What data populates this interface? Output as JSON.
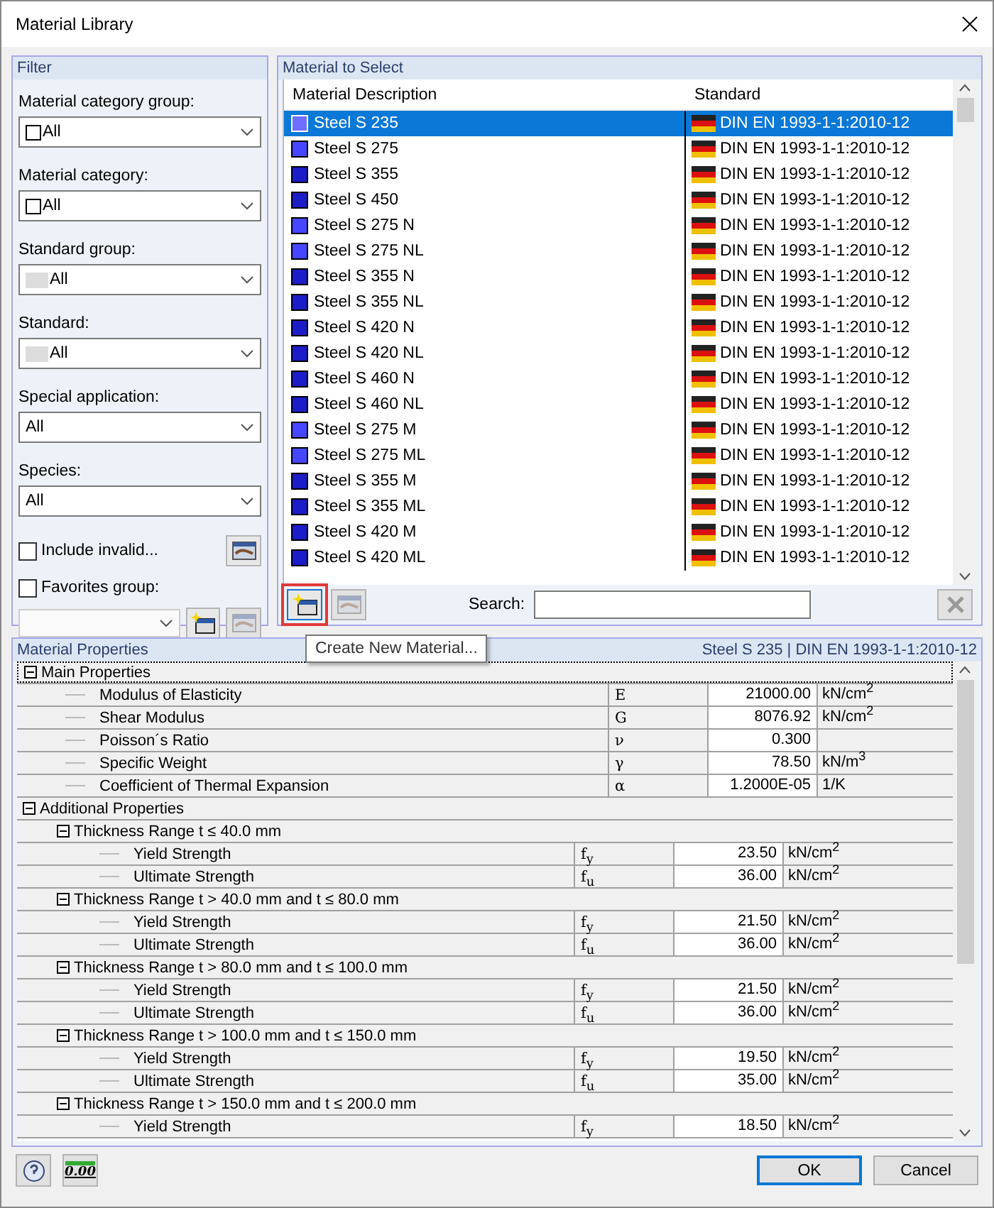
{
  "window": {
    "title": "Material Library"
  },
  "filter": {
    "title": "Filter",
    "fields": [
      {
        "kind": "outlined",
        "label": "Material category group:",
        "value": "All"
      },
      {
        "kind": "outlined",
        "label": "Material category:",
        "value": "All"
      },
      {
        "kind": "shaded",
        "label": "Standard group:",
        "value": "All"
      },
      {
        "kind": "shaded",
        "label": "Standard:",
        "value": "All"
      },
      {
        "kind": "plain",
        "label": "Special application:",
        "value": "All"
      },
      {
        "kind": "plain",
        "label": "Species:",
        "value": "All"
      }
    ],
    "include_invalid": {
      "label": "Include invalid...",
      "checked": false
    },
    "favorites_group": {
      "label": "Favorites group:",
      "checked": false
    }
  },
  "material_list": {
    "title": "Material to Select",
    "columns": [
      "Material Description",
      "Standard"
    ],
    "rows": [
      {
        "name": "Steel S 235",
        "color": "#6e6eff",
        "standard": "DIN EN 1993-1-1:2010-12",
        "selected": true
      },
      {
        "name": "Steel S 275",
        "color": "#4646ff",
        "standard": "DIN EN 1993-1-1:2010-12",
        "selected": false
      },
      {
        "name": "Steel S 355",
        "color": "#1c1cc8",
        "standard": "DIN EN 1993-1-1:2010-12",
        "selected": false
      },
      {
        "name": "Steel S 450",
        "color": "#1c1cc8",
        "standard": "DIN EN 1993-1-1:2010-12",
        "selected": false
      },
      {
        "name": "Steel S 275 N",
        "color": "#4646ff",
        "standard": "DIN EN 1993-1-1:2010-12",
        "selected": false
      },
      {
        "name": "Steel S 275 NL",
        "color": "#4646ff",
        "standard": "DIN EN 1993-1-1:2010-12",
        "selected": false
      },
      {
        "name": "Steel S 355 N",
        "color": "#1c1cc8",
        "standard": "DIN EN 1993-1-1:2010-12",
        "selected": false
      },
      {
        "name": "Steel S 355 NL",
        "color": "#1c1cc8",
        "standard": "DIN EN 1993-1-1:2010-12",
        "selected": false
      },
      {
        "name": "Steel S 420 N",
        "color": "#1c1cc8",
        "standard": "DIN EN 1993-1-1:2010-12",
        "selected": false
      },
      {
        "name": "Steel S 420 NL",
        "color": "#1c1cc8",
        "standard": "DIN EN 1993-1-1:2010-12",
        "selected": false
      },
      {
        "name": "Steel S 460 N",
        "color": "#1c1cc8",
        "standard": "DIN EN 1993-1-1:2010-12",
        "selected": false
      },
      {
        "name": "Steel S 460 NL",
        "color": "#1c1cc8",
        "standard": "DIN EN 1993-1-1:2010-12",
        "selected": false
      },
      {
        "name": "Steel S 275 M",
        "color": "#4646ff",
        "standard": "DIN EN 1993-1-1:2010-12",
        "selected": false
      },
      {
        "name": "Steel S 275 ML",
        "color": "#4646ff",
        "standard": "DIN EN 1993-1-1:2010-12",
        "selected": false
      },
      {
        "name": "Steel S 355 M",
        "color": "#1c1cc8",
        "standard": "DIN EN 1993-1-1:2010-12",
        "selected": false
      },
      {
        "name": "Steel S 355 ML",
        "color": "#1c1cc8",
        "standard": "DIN EN 1993-1-1:2010-12",
        "selected": false
      },
      {
        "name": "Steel S 420 M",
        "color": "#1c1cc8",
        "standard": "DIN EN 1993-1-1:2010-12",
        "selected": false
      },
      {
        "name": "Steel S 420 ML",
        "color": "#1c1cc8",
        "standard": "DIN EN 1993-1-1:2010-12",
        "selected": false
      }
    ],
    "search_label": "Search:"
  },
  "tooltip": "Create New Material...",
  "properties": {
    "title": "Material Properties",
    "material": "Steel S 235",
    "separator": "|",
    "standard": "DIN EN 1993-1-1:2010-12",
    "items": [
      {
        "kind": "group",
        "label": "Main Properties",
        "expanded": true,
        "children": [
          {
            "kind": "property",
            "label": "Modulus of Elasticity",
            "symbol": "E",
            "value": "21000.00",
            "unit": "kN/cm$^{2}$"
          },
          {
            "kind": "property",
            "label": "Shear Modulus",
            "symbol": "G",
            "value": "8076.92",
            "unit": "kN/cm$^{2}$"
          },
          {
            "kind": "property",
            "label": "Poisson´s Ratio",
            "symbol": "ν",
            "value": "0.300"
          },
          {
            "kind": "property",
            "label": "Specific Weight",
            "symbol": "γ",
            "value": "78.50",
            "unit": "kN/m$^{3}$"
          },
          {
            "kind": "property",
            "label": "Coefficient of Thermal Expansion",
            "symbol": "α",
            "value": "1.2000E-05",
            "unit": "1/K"
          }
        ]
      },
      {
        "kind": "group",
        "label": "Additional Properties",
        "expanded": true,
        "children": [
          {
            "kind": "group",
            "label": "Thickness Range t ≤ 40.0 mm",
            "expanded": true,
            "children": [
              {
                "kind": "property",
                "label": "Yield Strength",
                "symbol": "f$_{y}$",
                "value": "23.50",
                "unit": "kN/cm$^{2}$"
              },
              {
                "kind": "property",
                "label": "Ultimate Strength",
                "symbol": "f$_{u}$",
                "value": "36.00",
                "unit": "kN/cm$^{2}$"
              }
            ]
          },
          {
            "kind": "group",
            "label": "Thickness Range t > 40.0 mm and t ≤ 80.0 mm",
            "expanded": true,
            "children": [
              {
                "kind": "property",
                "label": "Yield Strength",
                "symbol": "f$_{y}$",
                "value": "21.50",
                "unit": "kN/cm$^{2}$"
              },
              {
                "kind": "property",
                "label": "Ultimate Strength",
                "symbol": "f$_{u}$",
                "value": "36.00",
                "unit": "kN/cm$^{2}$"
              }
            ]
          },
          {
            "kind": "group",
            "label": "Thickness Range t > 80.0 mm and t ≤ 100.0 mm",
            "expanded": true,
            "children": [
              {
                "kind": "property",
                "label": "Yield Strength",
                "symbol": "f$_{y}$",
                "value": "21.50",
                "unit": "kN/cm$^{2}$"
              },
              {
                "kind": "property",
                "label": "Ultimate Strength",
                "symbol": "f$_{u}$",
                "value": "36.00",
                "unit": "kN/cm$^{2}$"
              }
            ]
          },
          {
            "kind": "group",
            "label": "Thickness Range t > 100.0 mm and t ≤ 150.0 mm",
            "expanded": true,
            "children": [
              {
                "kind": "property",
                "label": "Yield Strength",
                "symbol": "f$_{y}$",
                "value": "19.50",
                "unit": "kN/cm$^{2}$"
              },
              {
                "kind": "property",
                "label": "Ultimate Strength",
                "symbol": "f$_{u}$",
                "value": "35.00",
                "unit": "kN/cm$^{2}$"
              }
            ]
          },
          {
            "kind": "group",
            "label": "Thickness Range t > 150.0 mm and t ≤ 200.0 mm",
            "expanded": true,
            "children": [
              {
                "kind": "property",
                "label": "Yield Strength",
                "symbol": "f$_{y}$",
                "value": "18.50",
                "unit": "kN/cm$^{2}$"
              }
            ]
          }
        ]
      }
    ]
  },
  "units_button": "0.00",
  "buttons": [
    "OK",
    "Cancel"
  ]
}
